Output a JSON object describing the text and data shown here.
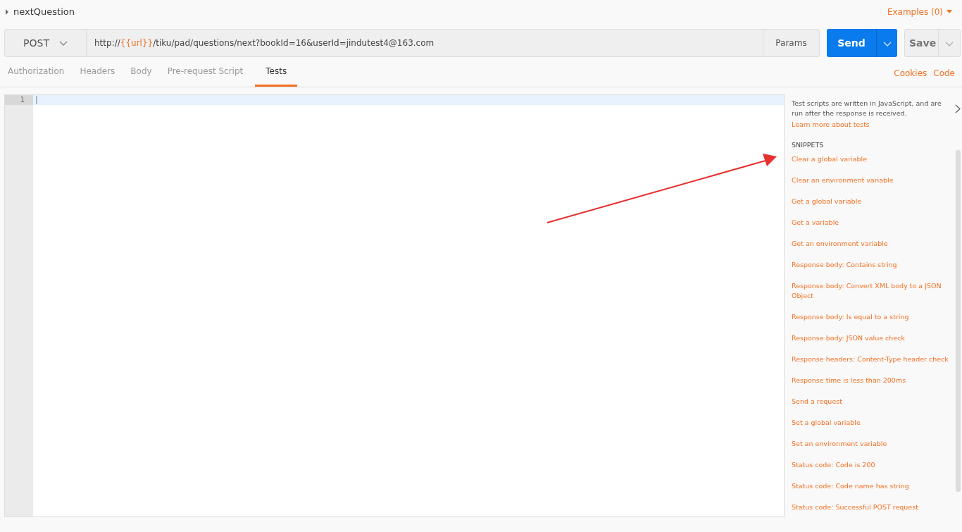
{
  "request": {
    "name": "nextQuestion",
    "expanded": false,
    "examples": "Examples (0)"
  },
  "url_bar": {
    "method": "POST",
    "url_parts": [
      {
        "kind": "text",
        "text": "http://"
      },
      {
        "kind": "variable",
        "text": "{{url}}"
      },
      {
        "kind": "text",
        "text": "/tiku/pad/questions/next?bookId=16&userId=jindutest4@163.com"
      }
    ],
    "params": "Params",
    "send": "Send",
    "save": "Save"
  },
  "tabs": [
    {
      "label": "Authorization",
      "selected": false
    },
    {
      "label": "Headers",
      "selected": false
    },
    {
      "label": "Body",
      "selected": false
    },
    {
      "label": "Pre-request Script",
      "selected": false
    },
    {
      "label": "Tests",
      "selected": true
    }
  ],
  "tab_links": [
    "Cookies",
    "Code"
  ],
  "editor": {
    "line_numbers": [
      "1"
    ]
  },
  "side_panel": {
    "description": "Test scripts are written in JavaScript, and are run after the response is received.",
    "learn_more": "Learn more about tests",
    "snippets_heading": "SNIPPETS",
    "snippets": [
      "Clear a global variable",
      "Clear an environment variable",
      "Get a global variable",
      "Get a variable",
      "Get an environment variable",
      "Response body: Contains string",
      "Response body: Convert XML body to a JSON Object",
      "Response body: Is equal to a string",
      "Response body: JSON value check",
      "Response headers: Content-Type header check",
      "Response time is less than 200ms",
      "Send a request",
      "Set a global variable",
      "Set an environment variable",
      "Status code: Code is 200",
      "Status code: Code name has string",
      "Status code: Successful POST request"
    ]
  }
}
